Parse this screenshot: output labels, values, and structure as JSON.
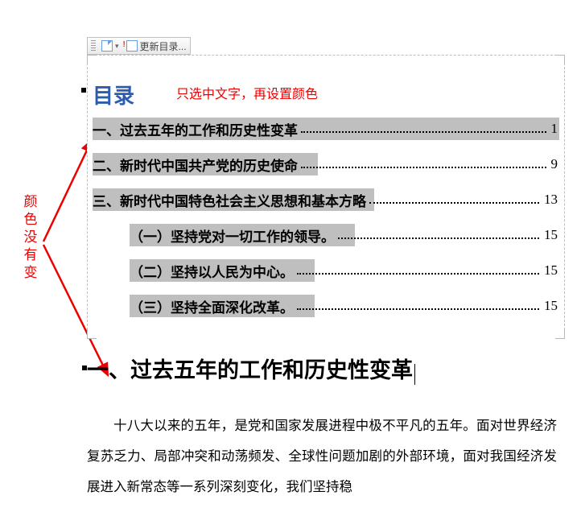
{
  "annotations": {
    "left_label": "颜色没有变",
    "hint": "只选中文字，再设置颜色"
  },
  "toolbar": {
    "update_toc": "更新目录..."
  },
  "toc": {
    "title": "目录",
    "entries": [
      {
        "text": "一、过去五年的工作和历史性变革",
        "page": "1",
        "level": 1
      },
      {
        "text": "二、新时代中国共产党的历史使命",
        "page": "9",
        "level": 1
      },
      {
        "text": "三、新时代中国特色社会主义思想和基本方略",
        "page": "13",
        "level": 1
      },
      {
        "text": "（一）坚持党对一切工作的领导。",
        "page": "15",
        "level": 2
      },
      {
        "text": "（二）坚持以人民为中心。",
        "page": "15",
        "level": 2
      },
      {
        "text": "（三）坚持全面深化改革。",
        "page": "15",
        "level": 2
      }
    ]
  },
  "heading": "一、过去五年的工作和历史性变革",
  "body": "十八大以来的五年，是党和国家发展进程中极不平凡的五年。面对世界经济复苏乏力、局部冲突和动荡频发、全球性问题加剧的外部环境，面对我国经济发展进入新常态等一系列深刻变化，我们坚持稳"
}
